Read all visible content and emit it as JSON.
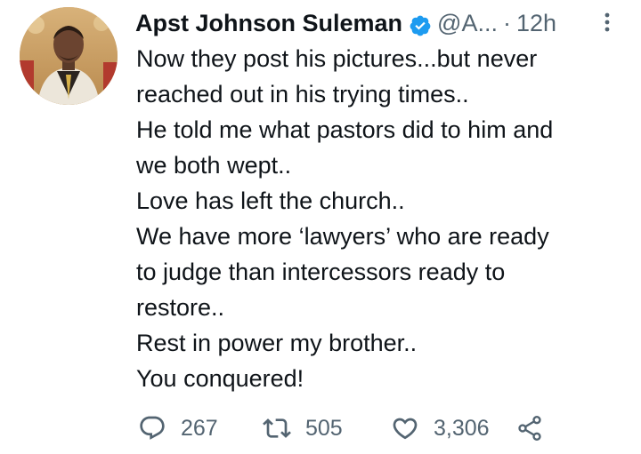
{
  "tweet": {
    "display_name": "Apst Johnson Suleman",
    "handle": "@A...",
    "separator": "·",
    "time": "12h",
    "lines": [
      "Now they post his pictures...but never",
      "reached out in his trying times..",
      "He told me what pastors did to him and",
      "we both wept..",
      "Love has left the church..",
      "We have more ‘lawyers’ who are ready",
      "to judge than intercessors ready to",
      "restore..",
      "Rest in power my brother..",
      "You conquered!"
    ],
    "reply_count": "267",
    "retweet_count": "505",
    "like_count": "3,306"
  },
  "icons": {
    "verified": "verified-badge-icon",
    "more": "more-vertical-icon",
    "reply": "reply-icon",
    "retweet": "retweet-icon",
    "like": "heart-icon",
    "share": "share-icon"
  },
  "colors": {
    "text": "#0f1419",
    "secondary": "#536471",
    "verified": "#1d9bf0"
  }
}
